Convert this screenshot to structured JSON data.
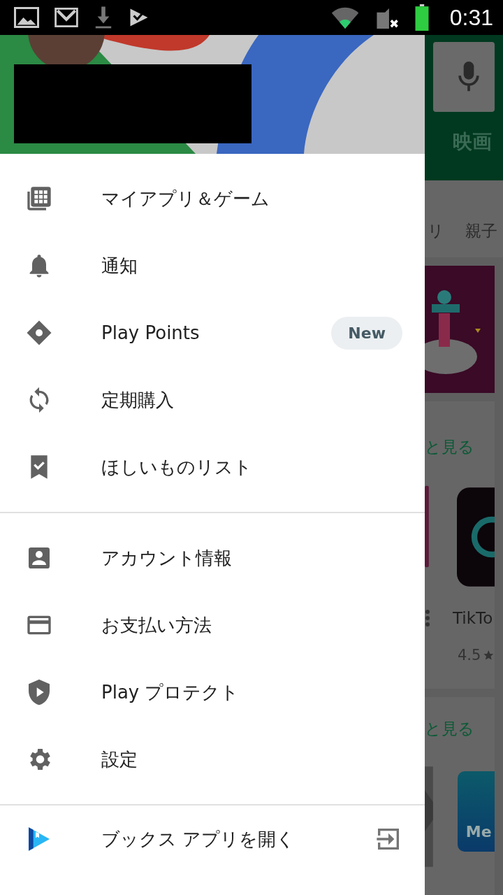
{
  "status_bar": {
    "time": "0:31"
  },
  "drawer": {
    "sections": [
      {
        "items": [
          {
            "label": "マイアプリ＆ゲーム"
          },
          {
            "label": "通知"
          },
          {
            "label": "Play Points",
            "badge": "New"
          },
          {
            "label": "定期購入"
          },
          {
            "label": "ほしいものリスト"
          }
        ]
      },
      {
        "items": [
          {
            "label": "アカウント情報"
          },
          {
            "label": "お支払い方法"
          },
          {
            "label": "Play プロテクト"
          },
          {
            "label": "設定"
          }
        ]
      }
    ],
    "footer_item": {
      "label": "ブックス アプリを開く"
    }
  },
  "background": {
    "tab_title": "映画",
    "categories": [
      "リ",
      "親子"
    ],
    "more_links": [
      "と見る",
      "と見る"
    ],
    "app": {
      "name": "TikTo",
      "rating": "4.5"
    },
    "second_app": "Me"
  }
}
